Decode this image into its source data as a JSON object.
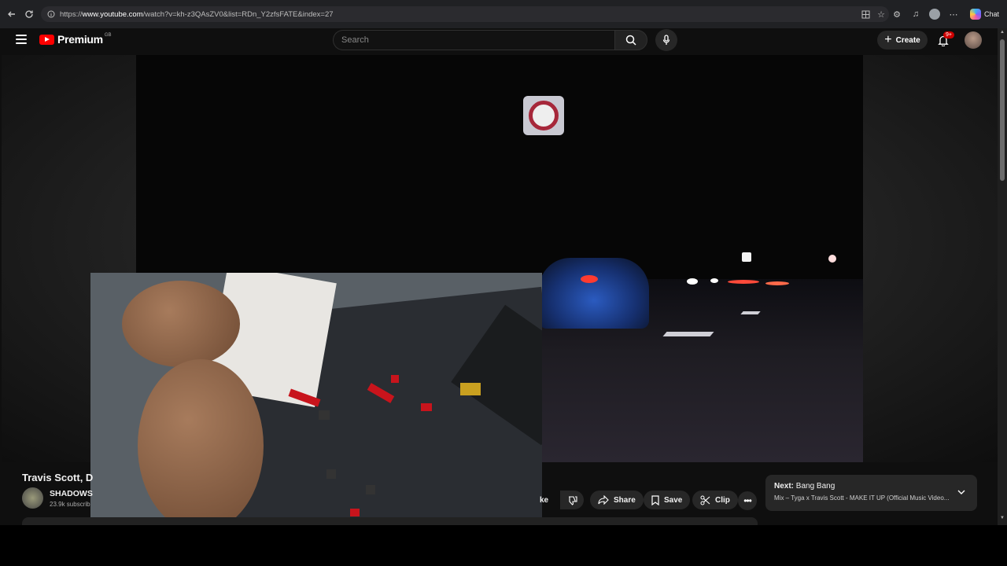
{
  "browser": {
    "url_prefix": "https://",
    "url_domain": "www.youtube.com",
    "url_path": "/watch?v=kh-z3QAsZV0&list=RDn_Y2zfsFATE&index=27",
    "chat_label": "Chat"
  },
  "header": {
    "logo_text": "Premium",
    "country_code": "GB",
    "search_placeholder": "Search",
    "create_label": "Create",
    "notification_badge": "9+"
  },
  "video": {
    "title": "Travis Scott, D",
    "channel_name": "SHADOWS",
    "subscribers": "23.9k subscrib"
  },
  "actions": {
    "like_label_partial": "ke",
    "share_label": "Share",
    "save_label": "Save",
    "clip_label": "Clip"
  },
  "up_next": {
    "prefix": "Next:",
    "title": "Bang Bang",
    "subtitle": "Mix – Tyga x Travis Scott - MAKE IT UP (Official Music Video..."
  },
  "colors": {
    "brand_red": "#ff0000",
    "bg": "#0f0f0f",
    "chip": "#272727"
  }
}
